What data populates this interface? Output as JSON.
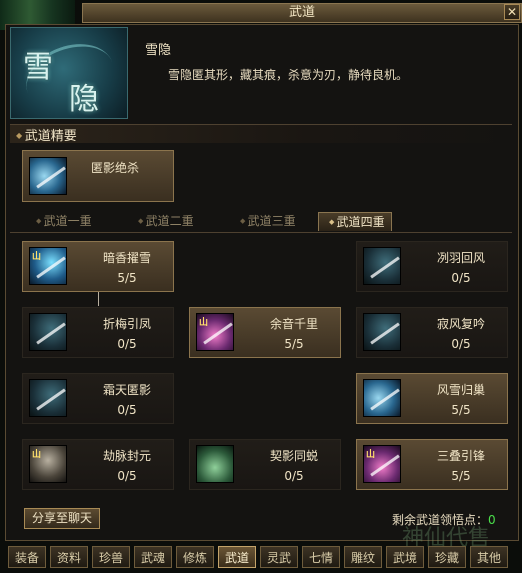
{
  "window": {
    "title": "武道",
    "help_label": "?",
    "close_label": "✕"
  },
  "skill": {
    "emblem_chars": [
      "雪",
      "隐"
    ],
    "title": "雪隐",
    "description": "雪隐匿其形，藏其痕，杀意为刃，静待良机。"
  },
  "featured": {
    "section_label": "武道精要",
    "name": "匿影绝杀",
    "icon": "shadow-assassin-icon"
  },
  "tier_tabs": [
    "武道一重",
    "武道二重",
    "武道三重",
    "武道四重"
  ],
  "active_tier": "武道四重",
  "nodes": [
    {
      "name": "暗香擢雪",
      "level": "5/5",
      "learned": true,
      "icon": "plum-snow-icon"
    },
    {
      "name": "冽羽回风",
      "level": "0/5",
      "learned": false,
      "icon": "feather-wind-icon"
    },
    {
      "name": "折梅引凤",
      "level": "0/5",
      "learned": false,
      "icon": "plum-branch-icon"
    },
    {
      "name": "余音千里",
      "level": "5/5",
      "learned": true,
      "icon": "echo-strike-icon"
    },
    {
      "name": "寂风复吟",
      "level": "0/5",
      "learned": false,
      "icon": "silent-wind-icon"
    },
    {
      "name": "霜天匿影",
      "level": "0/5",
      "learned": false,
      "icon": "frost-shadow-icon"
    },
    {
      "name": "风雪归巢",
      "level": "5/5",
      "learned": true,
      "icon": "storm-nest-icon"
    },
    {
      "name": "劫脉封元",
      "level": "0/5",
      "learned": false,
      "icon": "seal-vein-icon"
    },
    {
      "name": "契影同蜕",
      "level": "0/5",
      "learned": false,
      "icon": "shadow-pact-icon"
    },
    {
      "name": "三叠引锋",
      "level": "5/5",
      "learned": true,
      "icon": "triple-blade-icon"
    }
  ],
  "footer": {
    "share_label": "分享至聊天",
    "remaining_label": "剩余武道领悟点：",
    "remaining_points": "0"
  },
  "watermark": "神仙代售",
  "bottom_tabs": [
    "装备",
    "资料",
    "珍兽",
    "武魂",
    "修炼",
    "武道",
    "灵武",
    "七情",
    "雕纹",
    "武境",
    "珍藏",
    "其他"
  ],
  "active_bottom_tab": "武道"
}
